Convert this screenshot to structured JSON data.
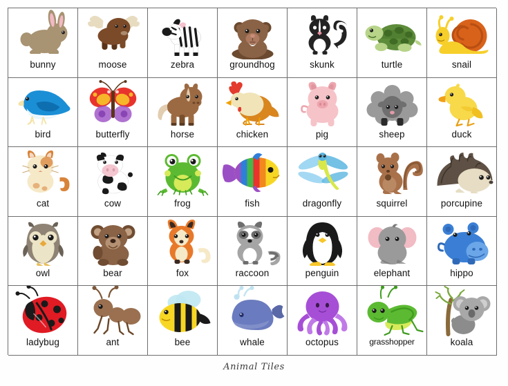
{
  "page": {
    "caption": "Animal Tiles",
    "background_color": "#ffffff",
    "grid_line_color": "#6d6d6d",
    "label_color": "#111111",
    "columns": 7,
    "rows": 5
  },
  "tiles": [
    {
      "label": "bunny",
      "icon": "bunny-icon",
      "colors": [
        "#a89372",
        "#f2b9c4",
        "#ffffff"
      ]
    },
    {
      "label": "moose",
      "icon": "moose-icon",
      "colors": [
        "#7b4a28",
        "#e8dcc0",
        "#5a3418"
      ]
    },
    {
      "label": "zebra",
      "icon": "zebra-icon",
      "colors": [
        "#ffffff",
        "#1a1a1a",
        "#f0a8b8"
      ]
    },
    {
      "label": "groundhog",
      "icon": "groundhog-icon",
      "colors": [
        "#8a6245",
        "#6b4a30",
        "#c98d78"
      ]
    },
    {
      "label": "skunk",
      "icon": "skunk-icon",
      "colors": [
        "#232323",
        "#ffffff",
        "#e8909f"
      ]
    },
    {
      "label": "turtle",
      "icon": "turtle-icon",
      "colors": [
        "#5d8c3a",
        "#b7d488",
        "#3f6b24"
      ]
    },
    {
      "label": "snail",
      "icon": "snail-icon",
      "colors": [
        "#f6cf2a",
        "#d9621a",
        "#b84f12"
      ]
    },
    {
      "label": "bird",
      "icon": "bird-icon",
      "colors": [
        "#1b8fd6",
        "#0e6fb0",
        "#f4e3a8"
      ]
    },
    {
      "label": "butterfly",
      "icon": "butterfly-icon",
      "colors": [
        "#e8342c",
        "#f7b52a",
        "#9b4fc4"
      ]
    },
    {
      "label": "horse",
      "icon": "horse-icon",
      "colors": [
        "#9c6a42",
        "#7a4f2c",
        "#e2cdb0"
      ]
    },
    {
      "label": "chicken",
      "icon": "chicken-icon",
      "colors": [
        "#f0e4b8",
        "#d9861f",
        "#e33b2e"
      ]
    },
    {
      "label": "pig",
      "icon": "pig-icon",
      "colors": [
        "#f6c3c8",
        "#eda6ae",
        "#d98a95"
      ]
    },
    {
      "label": "sheep",
      "icon": "sheep-icon",
      "colors": [
        "#9a9a9a",
        "#6f6f6f",
        "#2a2a2a"
      ]
    },
    {
      "label": "duck",
      "icon": "duck-icon",
      "colors": [
        "#f7d94a",
        "#f0c021",
        "#e8a016"
      ]
    },
    {
      "label": "cat",
      "icon": "cat-icon",
      "colors": [
        "#f6e9c8",
        "#d8833a",
        "#ffffff"
      ]
    },
    {
      "label": "cow",
      "icon": "cow-icon",
      "colors": [
        "#ffffff",
        "#1a1a1a",
        "#f4c6cf"
      ]
    },
    {
      "label": "frog",
      "icon": "frog-icon",
      "colors": [
        "#5cba32",
        "#3f9c1f",
        "#d6ea5a"
      ]
    },
    {
      "label": "fish",
      "icon": "fish-icon",
      "colors": [
        "#f7d724",
        "#e8342c",
        "#9b4fc4"
      ]
    },
    {
      "label": "dragonfly",
      "icon": "dragonfly-icon",
      "colors": [
        "#8fd0f0",
        "#d8e84a",
        "#5bb6e0"
      ]
    },
    {
      "label": "squirrel",
      "icon": "squirrel-icon",
      "colors": [
        "#a9714a",
        "#8a5a36",
        "#c59a74"
      ]
    },
    {
      "label": "porcupine",
      "icon": "porcupine-icon",
      "colors": [
        "#5e5044",
        "#e6ddc4",
        "#3c332b"
      ]
    },
    {
      "label": "owl",
      "icon": "owl-icon",
      "colors": [
        "#8e8374",
        "#6b6257",
        "#ece4c6"
      ]
    },
    {
      "label": "bear",
      "icon": "bear-icon",
      "colors": [
        "#8a6245",
        "#6f4c32",
        "#c2a183"
      ]
    },
    {
      "label": "fox",
      "icon": "fox-icon",
      "colors": [
        "#e8792a",
        "#f6e9c8",
        "#3a2a22"
      ]
    },
    {
      "label": "raccoon",
      "icon": "raccoon-icon",
      "colors": [
        "#a5a5a5",
        "#6e6e6e",
        "#ffffff"
      ]
    },
    {
      "label": "penguin",
      "icon": "penguin-icon",
      "colors": [
        "#1a1a1a",
        "#ffffff",
        "#f7c62a"
      ]
    },
    {
      "label": "elephant",
      "icon": "elephant-icon",
      "colors": [
        "#9a9a9a",
        "#f2bcc4",
        "#7a7a7a"
      ]
    },
    {
      "label": "hippo",
      "icon": "hippo-icon",
      "colors": [
        "#3a7fd5",
        "#2f6ab8",
        "#6aa6e8"
      ]
    },
    {
      "label": "ladybug",
      "icon": "ladybug-icon",
      "colors": [
        "#e01b24",
        "#1a1a1a",
        "#b3121a"
      ]
    },
    {
      "label": "ant",
      "icon": "ant-icon",
      "colors": [
        "#9a7050",
        "#7d5738",
        "#6a4628"
      ]
    },
    {
      "label": "bee",
      "icon": "bee-icon",
      "colors": [
        "#f7d724",
        "#1a1a1a",
        "#bfe8f2"
      ]
    },
    {
      "label": "whale",
      "icon": "whale-icon",
      "colors": [
        "#6b7bbf",
        "#5a68a8",
        "#bfe2f0"
      ]
    },
    {
      "label": "octopus",
      "icon": "octopus-icon",
      "colors": [
        "#a64fd6",
        "#8e3cc0",
        "#c07ae8"
      ]
    },
    {
      "label": "grasshopper",
      "icon": "grasshopper-icon",
      "colors": [
        "#5cba32",
        "#3f9c1f",
        "#d6ea5a"
      ]
    },
    {
      "label": "koala",
      "icon": "koala-icon",
      "colors": [
        "#a8a8a8",
        "#8c8c8c",
        "#7aa83c"
      ]
    }
  ]
}
